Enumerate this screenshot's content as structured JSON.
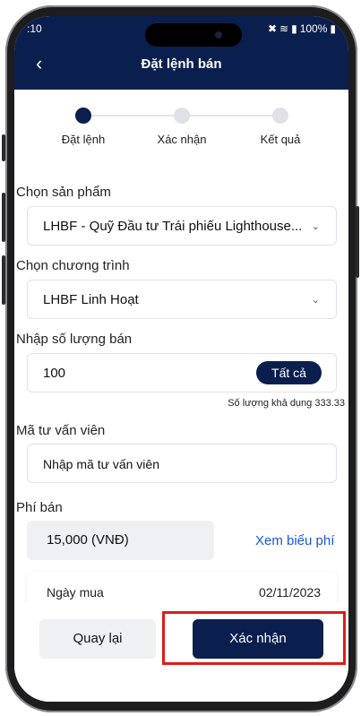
{
  "status_bar": {
    "time": ":10",
    "battery": "100%"
  },
  "header": {
    "title": "Đặt lệnh bán",
    "back_icon": "back-arrow-icon"
  },
  "stepper": {
    "steps": [
      "Đặt lệnh",
      "Xác nhận",
      "Kết quả"
    ],
    "active_index": 0
  },
  "form": {
    "product_label": "Chọn sản phẩm",
    "product_value": "LHBF - Quỹ Đầu tư Trái phiếu Lighthouse...",
    "program_label": "Chọn chương trình",
    "program_value": "LHBF Linh Hoạt",
    "quantity_label": "Nhập số lượng bán",
    "quantity_value": "100",
    "all_button": "Tất cả",
    "available_text": "Số lượng khả dụng  333.33",
    "advisor_label": "Mã tư vấn viên",
    "advisor_placeholder": "Nhập mã tư vấn viên",
    "fee_label": "Phí bán",
    "fee_value": "15,000 (VNĐ)",
    "fee_link": "Xem biểu phí",
    "buy_date_label": "Ngày mua",
    "buy_date_value": "02/11/2023"
  },
  "actions": {
    "back_label": "Quay lại",
    "confirm_label": "Xác nhận"
  },
  "colors": {
    "brand": "#0a1f4e",
    "link": "#1a56d6",
    "highlight": "#e11a1a"
  }
}
